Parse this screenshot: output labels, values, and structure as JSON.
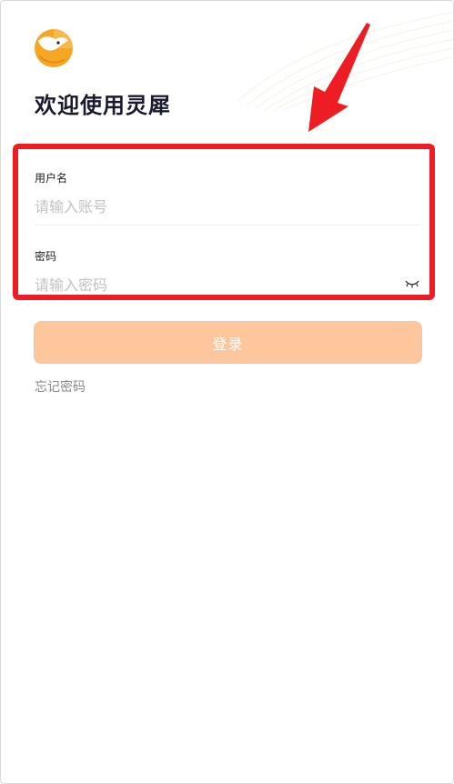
{
  "header": {
    "title": "欢迎使用灵犀",
    "logo_icon": "fox-logo-icon",
    "brand_color": "#f5a623"
  },
  "form": {
    "username": {
      "label": "用户名",
      "placeholder": "请输入账号",
      "value": ""
    },
    "password": {
      "label": "密码",
      "placeholder": "请输入密码",
      "value": "",
      "toggle_icon": "eye-closed-icon"
    },
    "login_label": "登录",
    "login_color": "#fec69c",
    "forgot_label": "忘记密码"
  },
  "annotation": {
    "highlight_color": "#ee1d24"
  }
}
